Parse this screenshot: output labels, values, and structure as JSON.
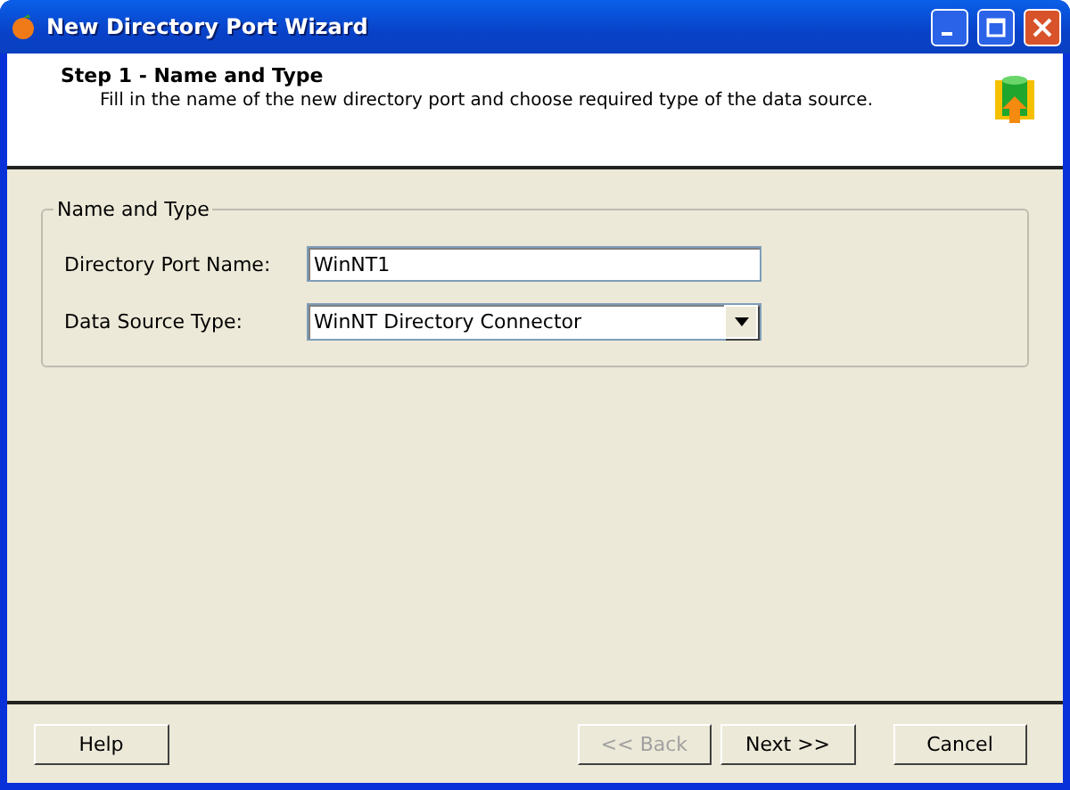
{
  "window": {
    "title": "New Directory Port Wizard"
  },
  "header": {
    "step": "Step 1 - Name and Type",
    "description": "Fill in the name of the new directory port and choose required type of the data source."
  },
  "group": {
    "title": "Name and Type",
    "fields": [
      {
        "kind": "text",
        "label": "Directory Port Name:",
        "value": "WinNT1"
      },
      {
        "kind": "dropdown",
        "label": "Data Source Type:",
        "value": "WinNT Directory Connector"
      }
    ]
  },
  "buttons": [
    {
      "label": "Help",
      "disabled": false
    },
    {
      "label": "<< Back",
      "disabled": true
    },
    {
      "label": "Next >>",
      "disabled": false
    },
    {
      "label": "Cancel",
      "disabled": false
    }
  ]
}
